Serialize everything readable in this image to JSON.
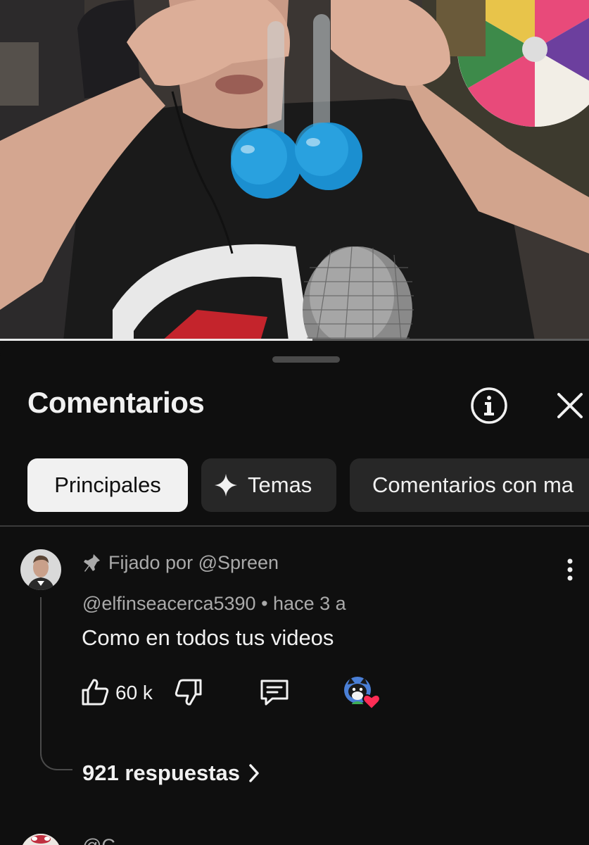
{
  "video": {
    "progress_fraction": 0.53
  },
  "sheet": {
    "title": "Comentarios",
    "info_icon": "info-circle-icon",
    "close_icon": "close-icon"
  },
  "chips": {
    "principales": "Principales",
    "temas": "Temas",
    "con": "Comentarios con ma"
  },
  "comment": {
    "pinned_label": "Fijado por @Spreen",
    "author": "@elfinseacerca5390",
    "time": "• hace 3 a",
    "text": "Como en todos tus videos",
    "likes": "60 k",
    "replies": "921 respuestas"
  },
  "next_comment": {
    "author_partial": "@C..."
  },
  "colors": {
    "background": "#0f0f0f",
    "chip": "#272727",
    "chip_active": "#f1f1f1",
    "secondary_text": "#aaaaaa",
    "heart": "#ff2d55"
  }
}
